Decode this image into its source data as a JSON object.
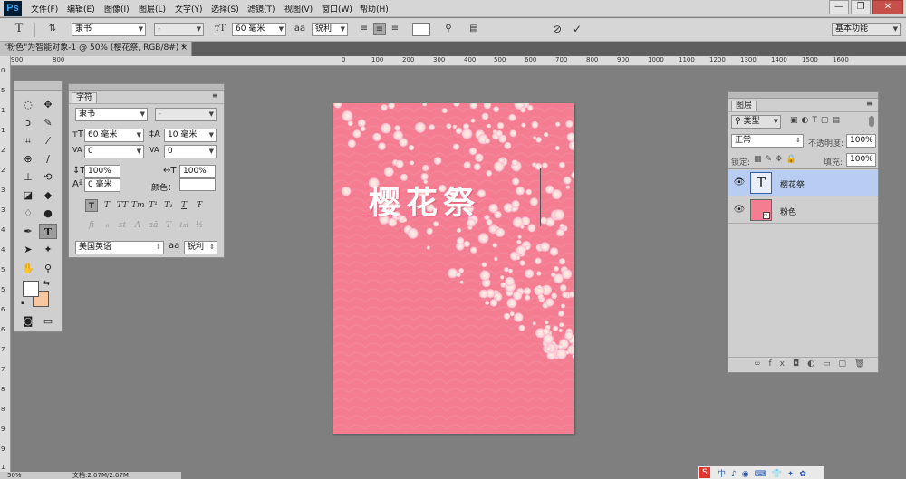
{
  "app": {
    "logo": "Ps"
  },
  "menu": [
    "文件(F)",
    "编辑(E)",
    "图像(I)",
    "图层(L)",
    "文字(Y)",
    "选择(S)",
    "滤镜(T)",
    "视图(V)",
    "窗口(W)",
    "帮助(H)"
  ],
  "window_controls": {
    "minimize": "—",
    "restore": "❐",
    "close": "✕"
  },
  "options_bar": {
    "tool_icon": "T",
    "font_family": "隶书",
    "font_style": "-",
    "font_size": "60 毫米",
    "aa_label": "a",
    "antialias": "锐利",
    "workspace": "基本功能"
  },
  "document_tab": {
    "title": "\"粉色\"为智能对象-1 @ 50% (樱花祭, RGB/8#) *",
    "close": "×"
  },
  "ruler": {
    "top": [
      "0",
      "100",
      "200",
      "300",
      "400",
      "500",
      "600",
      "700",
      "800",
      "900",
      "1000",
      "1100",
      "1200",
      "1300",
      "1400",
      "1500",
      "1600"
    ],
    "top_left": [
      "900",
      "800"
    ],
    "left": [
      "0",
      "5",
      "1",
      "1",
      "2",
      "2",
      "3",
      "3",
      "4",
      "4",
      "5",
      "5",
      "6",
      "6",
      "7",
      "7",
      "8",
      "8",
      "9",
      "9",
      "1"
    ]
  },
  "character_panel": {
    "tab": "字符",
    "font_family": "隶书",
    "font_style": "-",
    "font_size": "60 毫米",
    "leading": "10 毫米",
    "kerning": "0",
    "tracking": "0",
    "vscale": "100%",
    "hscale": "100%",
    "baseline": "0 毫米",
    "color_label": "颜色：",
    "language": "美国英语",
    "aa_label": "a",
    "antialias": "锐利",
    "format_buttons": [
      "T",
      "T",
      "TT",
      "Tт",
      "T¹",
      "T₁",
      "T",
      "Ŧ"
    ],
    "ot_buttons": [
      "fi",
      "ℴ",
      "st",
      "A",
      "aā",
      "T",
      "1st",
      "½"
    ]
  },
  "canvas": {
    "text": "樱花祭"
  },
  "layers_panel": {
    "tab": "图层",
    "filter_label": "类型",
    "blend_mode": "正常",
    "opacity_label": "不透明度:",
    "opacity": "100%",
    "lock_label": "锁定:",
    "fill_label": "填充:",
    "fill": "100%",
    "layers": [
      {
        "name": "樱花祭",
        "thumb": "T",
        "selected": true
      },
      {
        "name": "粉色",
        "thumb": "",
        "selected": false
      }
    ],
    "footer_icons": [
      "∞",
      "fx",
      "◘",
      "◐",
      "▭",
      "▢",
      "🗑"
    ]
  },
  "status": {
    "zoom": "50%",
    "doc": "文档:2.07M/2.07M"
  },
  "colors": {
    "canvas_pink": "#f47d92",
    "foreground": "#ffffff",
    "background": "#f7c89f",
    "selected_layer": "#b9cdf2"
  }
}
